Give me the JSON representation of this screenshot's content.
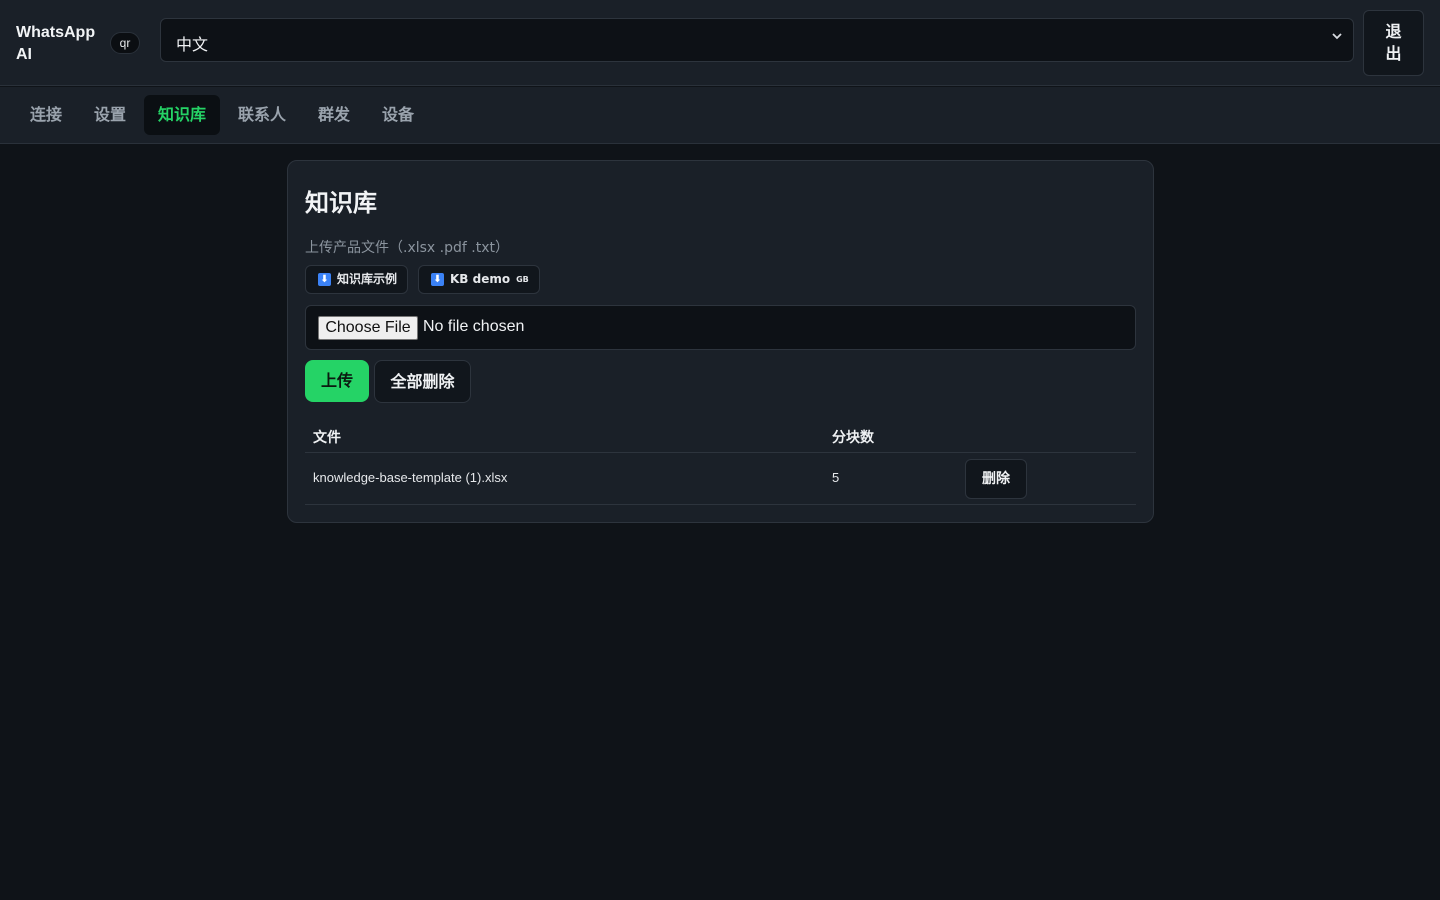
{
  "header": {
    "brand": "WhatsApp AI",
    "qr_badge": "qr",
    "language_value": "中文",
    "logout_label": "退出"
  },
  "tabs": [
    {
      "label": "连接",
      "active": false
    },
    {
      "label": "设置",
      "active": false
    },
    {
      "label": "知识库",
      "active": true
    },
    {
      "label": "联系人",
      "active": false
    },
    {
      "label": "群发",
      "active": false
    },
    {
      "label": "设备",
      "active": false
    }
  ],
  "knowledge": {
    "title": "知识库",
    "upload_hint": "上传产品文件（.xlsx .pdf .txt）",
    "demo_cn_label": "知识库示例",
    "demo_en_label": "KB demo",
    "demo_en_flag": "GB",
    "choose_file_label": "Choose File",
    "no_file_text": "No file chosen",
    "upload_label": "上传",
    "delete_all_label": "全部删除",
    "table": {
      "col_file": "文件",
      "col_chunks": "分块数",
      "rows": [
        {
          "file": "knowledge-base-template (1).xlsx",
          "chunks": "5",
          "delete_label": "删除"
        }
      ]
    }
  },
  "colors": {
    "accent": "#25d366",
    "background": "#0f1318",
    "panel": "#1a2028"
  }
}
